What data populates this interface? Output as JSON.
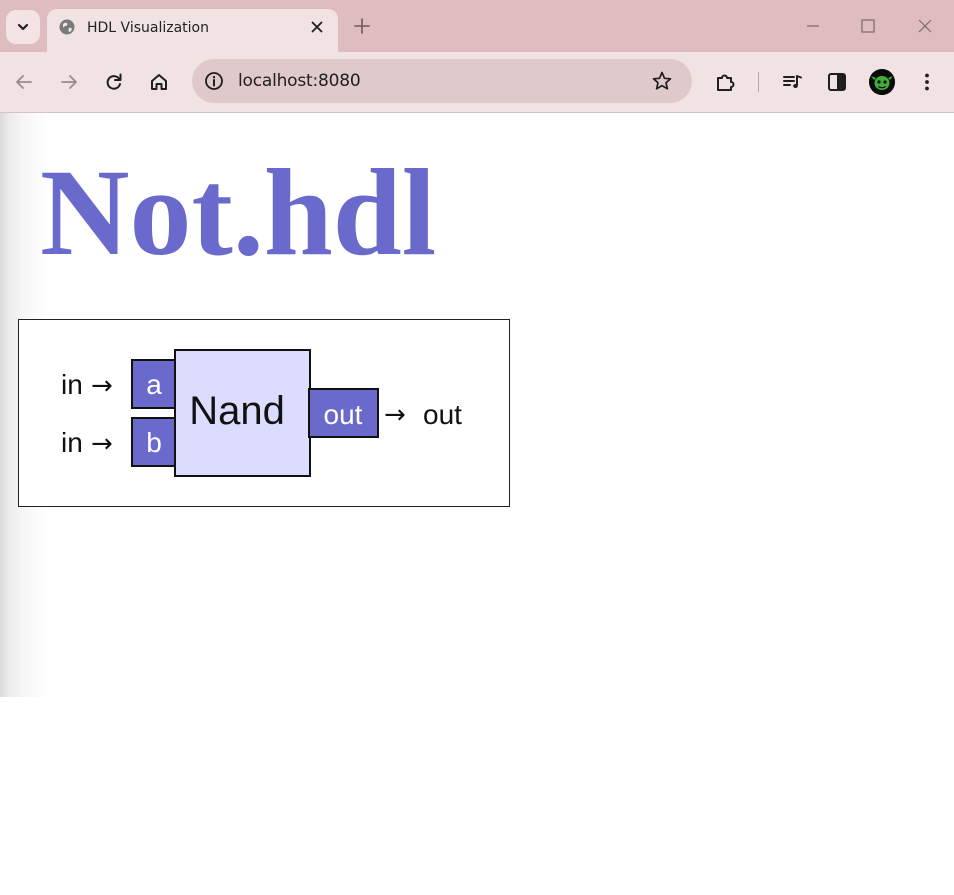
{
  "browser": {
    "tab": {
      "title": "HDL Visualization",
      "favicon": "globe-icon"
    },
    "address_bar": {
      "url": "localhost:8080"
    },
    "toolbar_icons": [
      "back-icon",
      "forward-icon",
      "reload-icon",
      "home-icon",
      "info-icon",
      "bookmark-star-icon",
      "extensions-icon",
      "media-control-icon",
      "side-panel-icon",
      "profile-avatar",
      "menu-icon"
    ],
    "colors": {
      "tab_strip": "#dfbcbf",
      "toolbar": "#f1e3e4",
      "omnibox": "#dfc9cb"
    }
  },
  "page": {
    "title": "Not.hdl",
    "title_color": "#6a6acd"
  },
  "diagram": {
    "chip": {
      "name": "Nand",
      "fill": "#dcdcff"
    },
    "pins": {
      "inputs": [
        {
          "name": "a",
          "wire": "in"
        },
        {
          "name": "b",
          "wire": "in"
        }
      ],
      "outputs": [
        {
          "name": "out",
          "wire": "out"
        }
      ],
      "fill": "#6a6acd"
    },
    "arrow": "→"
  }
}
